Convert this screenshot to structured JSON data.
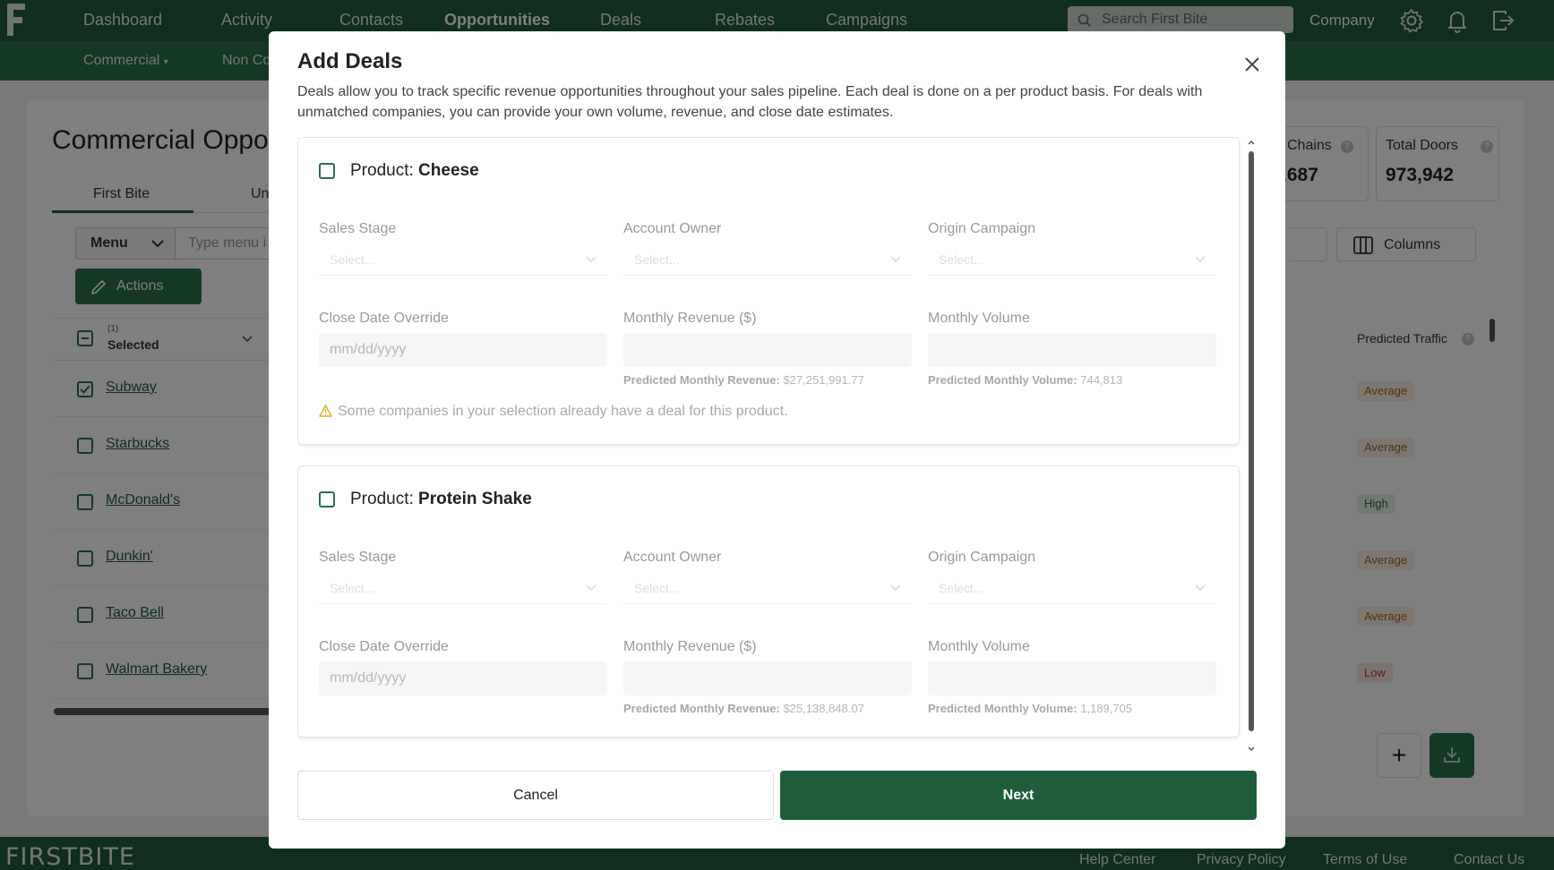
{
  "app": {
    "brand_footer": "FIRSTBITE",
    "nav": {
      "items": [
        "Dashboard",
        "Activity",
        "Contacts",
        "Opportunities",
        "Deals",
        "Rebates",
        "Campaigns"
      ],
      "active": "Opportunities",
      "search_placeholder": "Search First Bite",
      "company_label": "Company"
    },
    "subnav": {
      "items": [
        "Commercial",
        "Non Co"
      ]
    }
  },
  "page": {
    "title": "Commercial Oppor",
    "tabs": [
      "First Bite",
      "Un"
    ],
    "menu_label": "Menu",
    "menu_placeholder": "Type menu i",
    "actions_label": "Actions",
    "selected_count": "(1)",
    "selected_label": "Selected",
    "rows": [
      {
        "name": "Subway",
        "checked": true,
        "traffic": "Average"
      },
      {
        "name": "Starbucks",
        "checked": false,
        "traffic": "Average"
      },
      {
        "name": "McDonald's",
        "checked": false,
        "traffic": "High"
      },
      {
        "name": "Dunkin'",
        "checked": false,
        "traffic": "Average"
      },
      {
        "name": "Taco Bell",
        "checked": false,
        "traffic": "Average"
      },
      {
        "name": "Walmart Bakery",
        "checked": false,
        "traffic": "Low"
      }
    ],
    "stats": [
      {
        "label": "Chains",
        "value": ",687"
      },
      {
        "label": "Total Doors",
        "value": "973,942"
      }
    ],
    "columns_label": "Columns",
    "predicted_traffic_header": "Predicted Traffic",
    "fab_plus": "+"
  },
  "footer": {
    "links": [
      "Help Center",
      "Privacy Policy",
      "Terms of Use",
      "Contact Us"
    ]
  },
  "modal": {
    "title": "Add Deals",
    "description": "Deals allow you to track specific revenue opportunities throughout your sales pipeline. Each deal is done on a per product basis. For deals with unmatched companies, you can provide your own volume, revenue, and close date estimates.",
    "product_prefix": "Product:",
    "labels": {
      "sales_stage": "Sales Stage",
      "account_owner": "Account Owner",
      "origin_campaign": "Origin Campaign",
      "close_date": "Close Date Override",
      "monthly_revenue": "Monthly Revenue ($)",
      "monthly_volume": "Monthly Volume",
      "select_placeholder": "Select...",
      "date_placeholder": "mm/dd/yyyy",
      "predicted_revenue": "Predicted Monthly Revenue:",
      "predicted_volume": "Predicted Monthly Volume:"
    },
    "products": [
      {
        "name": "Cheese",
        "predicted_revenue": "$27,251,991.77",
        "predicted_volume": "744,813",
        "warning": "Some companies in your selection already have a deal for this product."
      },
      {
        "name": "Protein Shake",
        "predicted_revenue": "$25,138,848.07",
        "predicted_volume": "1,189,705"
      }
    ],
    "cancel_label": "Cancel",
    "next_label": "Next"
  },
  "colors": {
    "brand_dark": "#1e5c3a",
    "brand_sub": "#2a7048"
  }
}
